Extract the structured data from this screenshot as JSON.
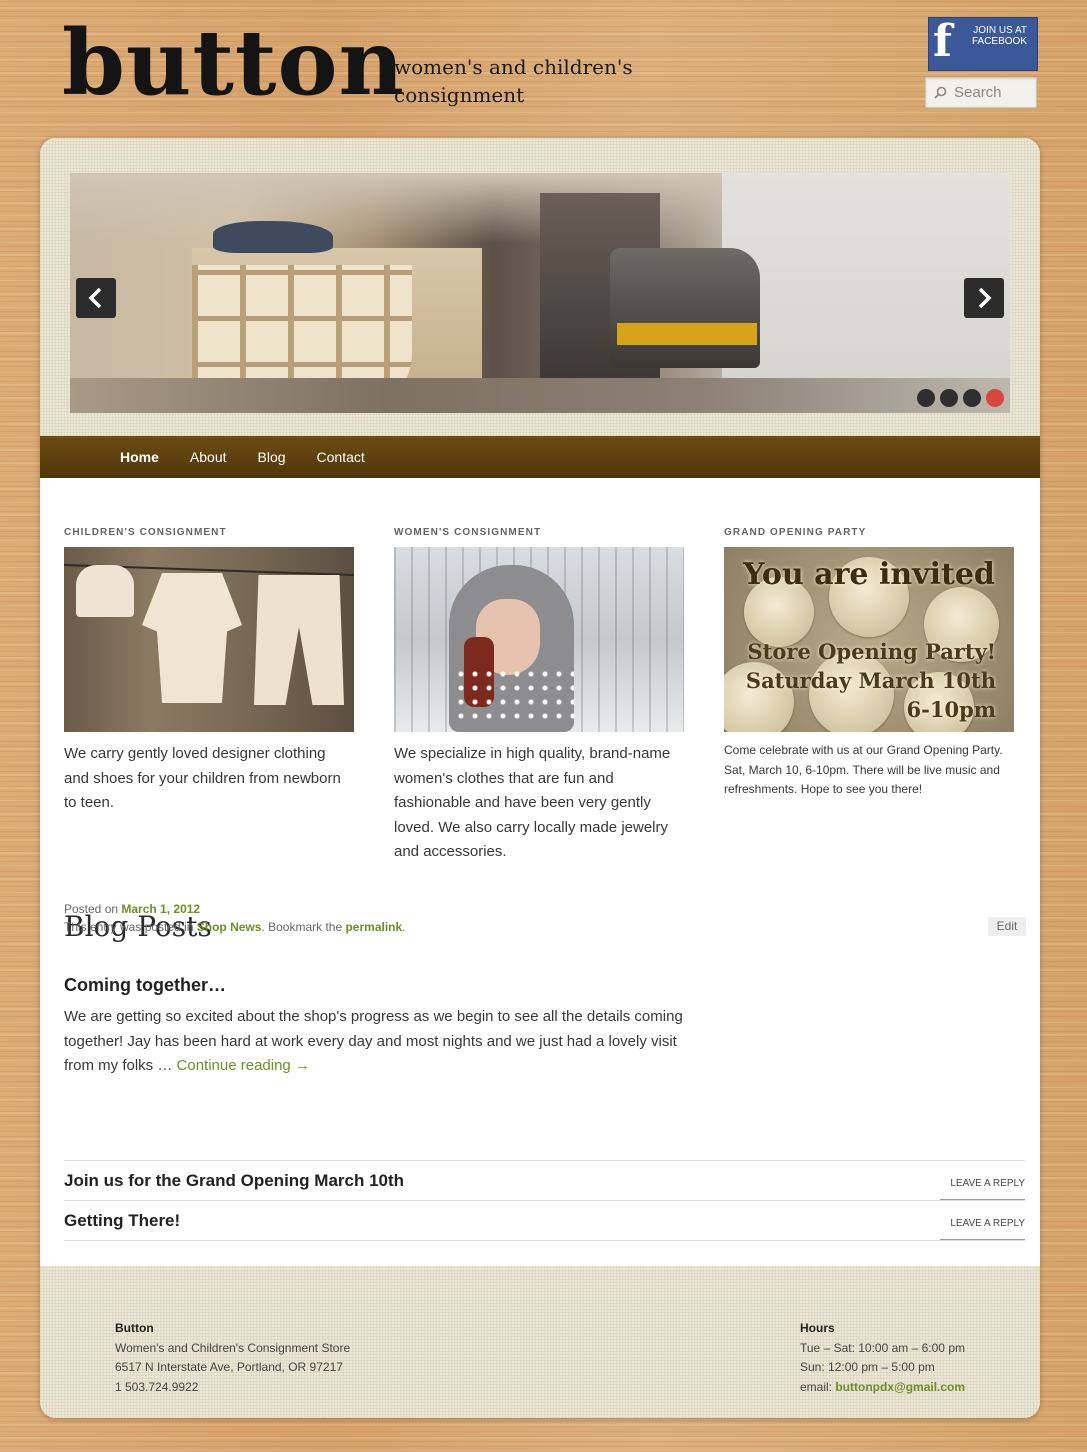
{
  "site": {
    "name": "button",
    "tagline": "women's and children's consignment"
  },
  "facebook": {
    "label": "JOIN US AT FACEBOOK",
    "icon": "facebook-icon"
  },
  "search": {
    "placeholder": "Search",
    "icon": "search-icon"
  },
  "slider": {
    "prev_icon": "chevron-left-icon",
    "next_icon": "chevron-right-icon",
    "slide_count": 4,
    "active_slide": 4,
    "active_color": "#d9473b"
  },
  "nav": {
    "items": [
      {
        "label": "Home",
        "current": true
      },
      {
        "label": "About",
        "current": false
      },
      {
        "label": "Blog",
        "current": false
      },
      {
        "label": "Contact",
        "current": false
      }
    ]
  },
  "features": [
    {
      "heading": "CHILDREN'S CONSIGNMENT",
      "text": "We carry gently loved designer clothing and shoes for your children from newborn to teen."
    },
    {
      "heading": "WOMEN'S CONSIGNMENT",
      "text": "We specialize in high quality, brand-name women's clothes that are fun and fashionable and have been very gently loved. We also carry locally made jewelry and accessories."
    },
    {
      "heading": "GRAND OPENING PARTY",
      "image_text": {
        "line1": "You are invited",
        "line2": "Store Opening Party!",
        "line3": "Saturday March 10th",
        "line4": "6-10pm"
      },
      "text": "Come celebrate with us at our Grand Opening Party. Sat, March 10, 6-10pm. There will be live music and refreshments. Hope to see you there!"
    }
  ],
  "blog": {
    "heading": "Blog Posts",
    "featured_post": {
      "title": "Coming together…",
      "excerpt": "We are getting so excited about the shop's progress as we begin to see all the details coming together!  Jay has been hard at work every day and most nights and we just had a lovely visit from my folks … ",
      "continue_label": "Continue reading →",
      "posted_on_prefix": "Posted on ",
      "date": "March 1, 2012",
      "category_prefix": "This entry was posted in ",
      "category": "Shop News",
      "bookmark_prefix": ". Bookmark the ",
      "permalink_label": "permalink",
      "bookmark_suffix": ".",
      "edit_label": "Edit"
    },
    "other_posts": [
      {
        "title": "Join us for the Grand Opening March 10th",
        "reply_label": "LEAVE A REPLY"
      },
      {
        "title": "Getting There!",
        "reply_label": "LEAVE A REPLY"
      }
    ]
  },
  "footer": {
    "business": {
      "name": "Button",
      "description": "Women's and Children's Consignment Store",
      "address": "6517 N Interstate Ave, Portland, OR 97217",
      "phone": "1 503.724.9922"
    },
    "hours": {
      "heading": "Hours",
      "weekdays": "Tue – Sat: 10:00 am – 6:00 pm",
      "sunday": "Sun: 12:00 pm – 5:00 pm",
      "email_prefix": "email: ",
      "email": "buttonpdx@gmail.com"
    }
  },
  "colors": {
    "nav_brown": "#5c3f0c",
    "link_green": "#6e8e28",
    "facebook_blue": "#3b5998"
  }
}
